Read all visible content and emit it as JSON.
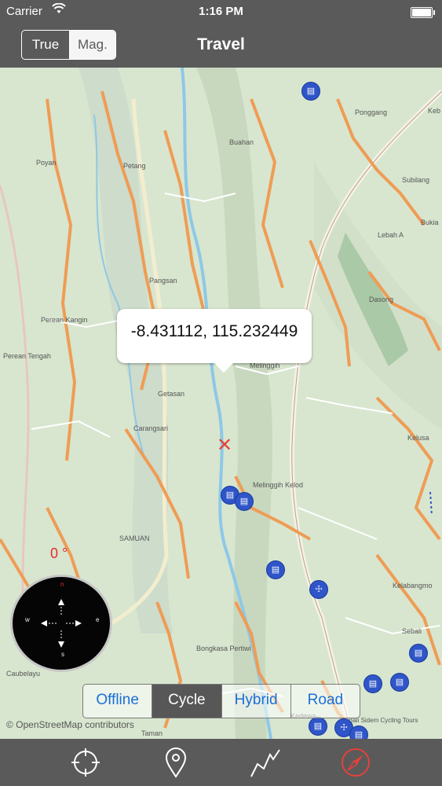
{
  "status": {
    "carrier": "Carrier",
    "time": "1:16 PM"
  },
  "nav": {
    "seg_true": "True",
    "seg_mag": "Mag.",
    "title": "Travel"
  },
  "map": {
    "coordinates": "-8.431112, 115.232449",
    "places": {
      "poyan": "Poyan",
      "petang": "Petang",
      "buahan": "Buahan",
      "ponggang": "Ponggang",
      "subilang": "Subilang",
      "bukia": "Bukia",
      "lebah_a": "Lebah A",
      "dasong": "Dasong",
      "pangsan": "Pangsan",
      "perean_kangin": "Perean Kangin",
      "perean_tengah": "Perean Tengah",
      "melinggih": "Melinggih",
      "getasan": "Getasan",
      "carangsari": "Carangsari",
      "melinggih_kelod": "Melinggih Kelod",
      "kelusa": "Kelusa",
      "samuan": "SAMUAN",
      "kelabangmoding": "Kelabangmo",
      "sebali": "Sebali",
      "bongkasa_pertiwi": "Bongkasa Pertiwi",
      "caubelayu": "Caubelayu",
      "taman": "Taman",
      "kedewatan": "Kedewa",
      "cycling_tours": "Bali Sidem Cycling Tours",
      "keb": "Keb"
    },
    "attribution": "© OpenStreetMap contributors"
  },
  "compass": {
    "heading": "0 °",
    "n": "n",
    "s": "s",
    "e": "e",
    "w": "w"
  },
  "map_types": {
    "offline": "Offline",
    "cycle": "Cycle",
    "hybrid": "Hybrid",
    "road": "Road",
    "selected": "Cycle"
  },
  "tabbar": {
    "icons": [
      "crosshair-icon",
      "location-pin-icon",
      "track-icon",
      "compass-icon"
    ],
    "active_color": "#e5413b"
  }
}
